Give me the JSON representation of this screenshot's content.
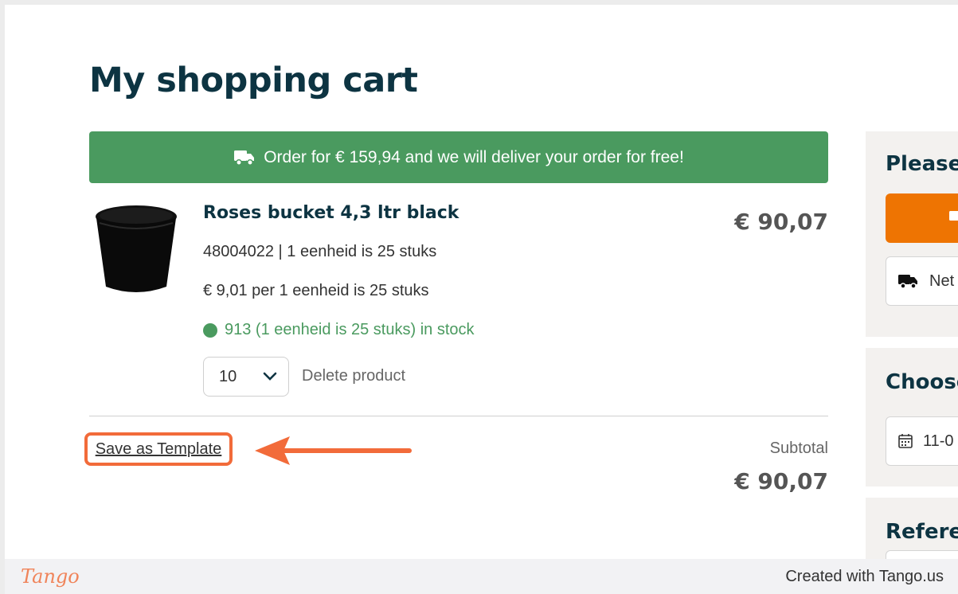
{
  "page": {
    "title": "My shopping cart"
  },
  "banner": {
    "icon": "truck-icon",
    "text": "Order for € 159,94 and we will deliver your order for free!"
  },
  "product": {
    "image": "black-bucket-image",
    "name": "Roses bucket 4,3 ltr black",
    "price": "€ 90,07",
    "sku_line": "48004022 | 1 eenheid is 25 stuks",
    "unit_price_line": "€ 9,01 per 1 eenheid is 25 stuks",
    "stock_line": "913 (1 eenheid is 25 stuks) in stock",
    "quantity": "10",
    "delete_label": "Delete product"
  },
  "cart": {
    "save_template_label": "Save as Template",
    "subtotal_label": "Subtotal",
    "subtotal_value": "€ 90,07"
  },
  "sidebar": {
    "panel1_heading": "Please",
    "delivery_option_text": "Net",
    "panel2_heading": "Choose",
    "date_value": "11-0",
    "panel3_heading": "Referer"
  },
  "footer": {
    "logo": "Tango",
    "credit": "Created with Tango.us"
  },
  "colors": {
    "title": "#0d3442",
    "banner_green": "#4a9a5f",
    "highlight_orange": "#f26b3a",
    "button_orange": "#ee7402"
  }
}
